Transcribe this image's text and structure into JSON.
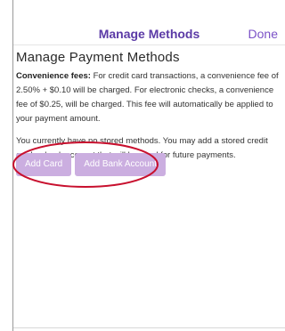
{
  "header": {
    "title": "Manage Methods",
    "done_label": "Done"
  },
  "main": {
    "heading": "Manage Payment Methods",
    "fees_label": "Convenience fees:",
    "fees_text": " For credit card transactions, a convenience fee of 2.50% + $0.10 will be charged. For electronic checks, a convenience fee of $0.25, will be charged. This fee will automatically be applied to your payment amount.",
    "no_methods_text": "You currently have no stored methods. You may add a stored credit card or bank account that will be used for future payments.",
    "buttons": {
      "add_card": "Add Card",
      "add_bank": "Add Bank Account"
    }
  },
  "colors": {
    "header_title": "#5b3aa6",
    "done": "#7b52c7",
    "button_bg": "#cbaee0",
    "annotation": "#c8102e"
  }
}
